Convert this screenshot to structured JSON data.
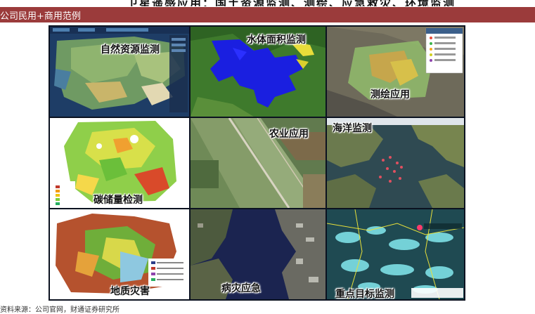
{
  "header": {
    "cut_text": "卫星遥感应用：国土资源监测、测绘、应急救灾、环境监测",
    "section_title": "公司民用+商用范例"
  },
  "tiles": {
    "natural_resources": "自然资源监测",
    "water_area": "水体面积监测",
    "surveying": "测绘应用",
    "carbon_storage": "碳储量检测",
    "agriculture": "农业应用",
    "ocean": "海洋监测",
    "geo_hazard": "地质灾害",
    "disaster_emergency": "病灾应急",
    "key_target": "重点目标监测"
  },
  "source": "资料来源：公司官网，财通证券研究所"
}
